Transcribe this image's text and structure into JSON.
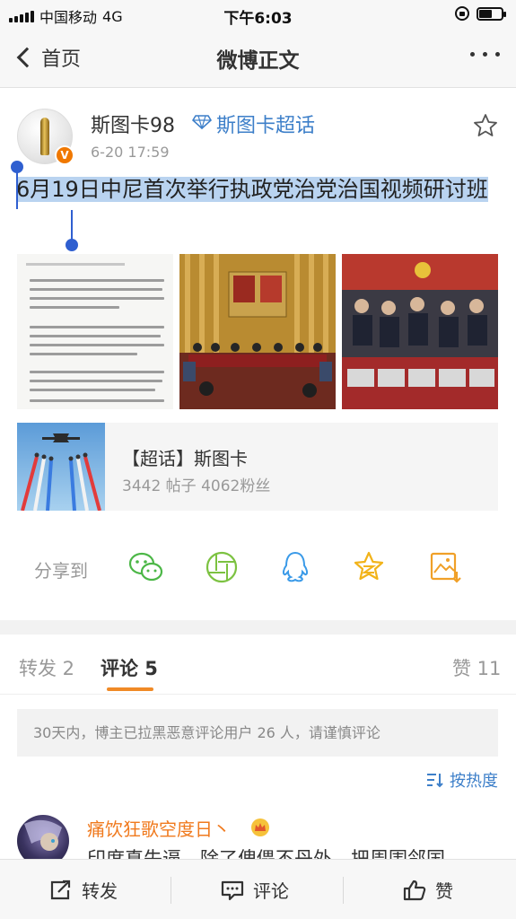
{
  "status_bar": {
    "carrier": "中国移动",
    "network": "4G",
    "time": "下午6:03",
    "battery_level": 0.6
  },
  "nav": {
    "back_label": "首页",
    "title": "微博正文"
  },
  "post": {
    "author": "斯图卡98",
    "super_topic_link": "斯图卡超话",
    "timestamp": "6-20 17:59",
    "text": "6月19日中尼首次举行执政党治党治国视频研讨班",
    "images": [
      {
        "icon": "news-article-photo"
      },
      {
        "icon": "conference-hall-photo"
      },
      {
        "icon": "video-meeting-photo"
      }
    ]
  },
  "topic_card": {
    "title": "【超话】斯图卡",
    "stats": "3442 帖子 4062粉丝"
  },
  "share": {
    "label": "分享到",
    "targets": [
      {
        "name": "wechat-icon",
        "color": "#4cb747"
      },
      {
        "name": "moments-icon",
        "color": "#7cc241"
      },
      {
        "name": "qq-icon",
        "color": "#3a9ae8"
      },
      {
        "name": "qzone-icon",
        "color": "#f2b31a"
      },
      {
        "name": "save-image-icon",
        "color": "#f0a028"
      }
    ]
  },
  "tabs": {
    "repost": "转发 2",
    "comment": "评论 5",
    "like": "赞 11"
  },
  "notice": "30天内，博主已拉黑恶意评论用户 26 人，请谨慎评论",
  "sort_label": "按热度",
  "comment": {
    "author": "痛饮狂歌空度日丶",
    "text": "印度真失逼，除了傀儡不丹外，把周围邻国"
  },
  "bottom_bar": {
    "repost": "转发",
    "comment": "评论",
    "like": "赞"
  },
  "colors": {
    "accent_orange": "#f08a26",
    "link_blue": "#3d7fc9",
    "selection": "#b9d3f0"
  }
}
